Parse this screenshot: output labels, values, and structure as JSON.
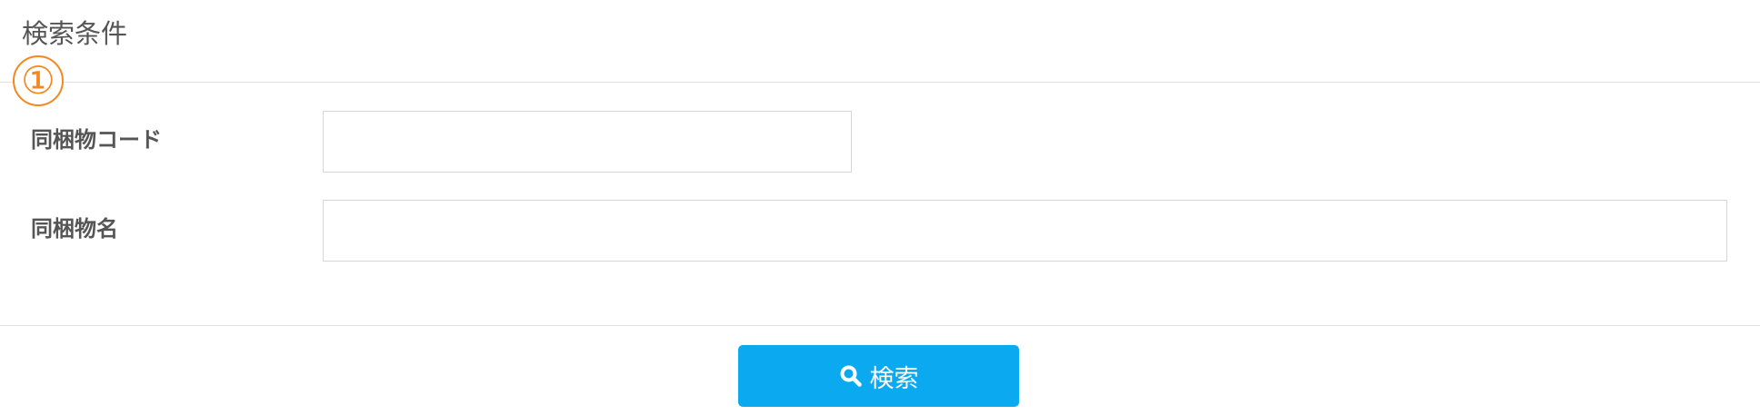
{
  "panel": {
    "title": "検索条件",
    "annotation_marker": "①"
  },
  "fields": {
    "bundle_code": {
      "label": "同梱物コード",
      "value": "",
      "placeholder": ""
    },
    "bundle_name": {
      "label": "同梱物名",
      "value": "",
      "placeholder": ""
    }
  },
  "actions": {
    "search_label": "検索",
    "search_icon": "search-icon"
  },
  "colors": {
    "accent": "#0ba9ef",
    "annotation": "#f6871f",
    "divider": "#dfdfdf"
  }
}
